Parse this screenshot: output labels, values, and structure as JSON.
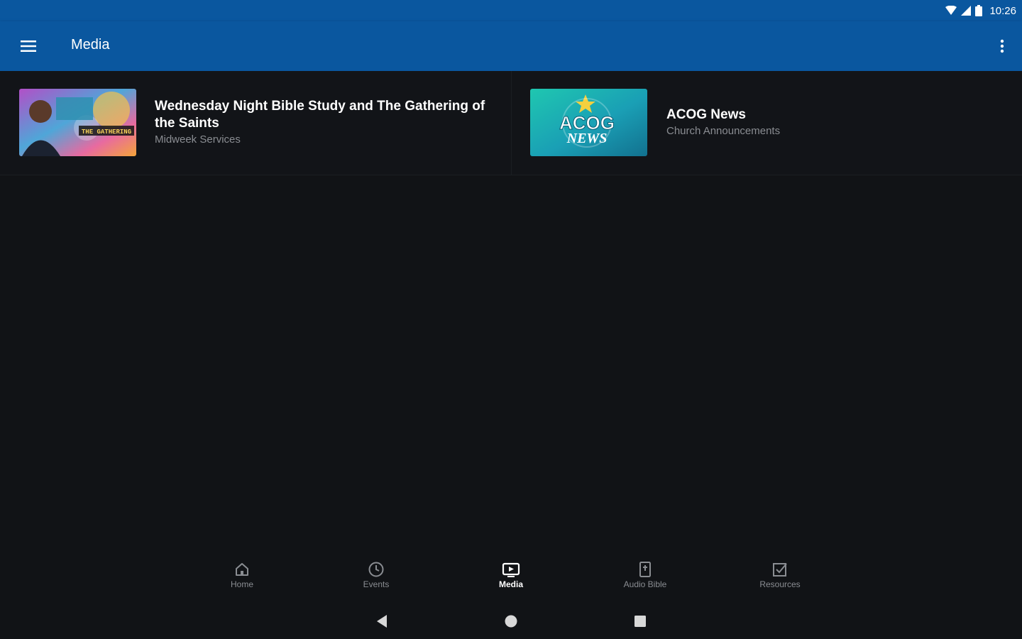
{
  "status_bar": {
    "time": "10:26"
  },
  "app_bar": {
    "title": "Media"
  },
  "media_items": [
    {
      "title": "Wednesday Night Bible Study and The Gathering of the Saints",
      "subtitle": "Midweek Services",
      "thumb_text": "THE GATHERING"
    },
    {
      "title": "ACOG News",
      "subtitle": "Church Announcements",
      "thumb_line1": "ACOG",
      "thumb_line2": "NEWS"
    }
  ],
  "bottom_nav": {
    "items": [
      {
        "label": "Home",
        "icon": "home-icon"
      },
      {
        "label": "Events",
        "icon": "clock-icon"
      },
      {
        "label": "Media",
        "icon": "tv-icon",
        "active": true
      },
      {
        "label": "Audio Bible",
        "icon": "bible-icon"
      },
      {
        "label": "Resources",
        "icon": "checkbox-icon"
      }
    ]
  },
  "colors": {
    "app_bar": "#0a579f",
    "background": "#111316",
    "secondary_text": "#8a8d92"
  }
}
